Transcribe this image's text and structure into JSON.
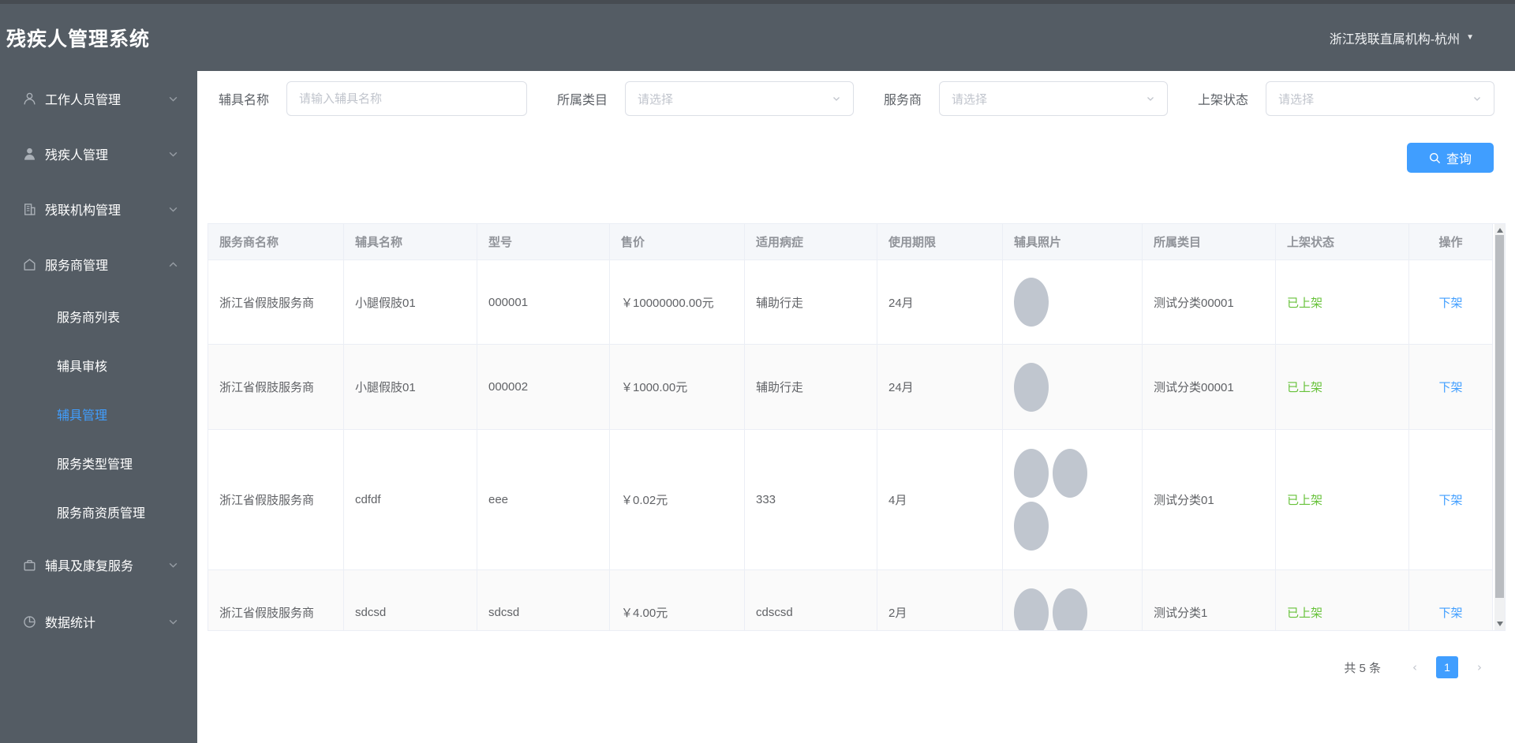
{
  "header": {
    "title": "残疾人管理系统",
    "org": "浙江残联直属机构-杭州"
  },
  "sidebar": {
    "items": [
      {
        "label": "工作人员管理",
        "icon": "user-outline-icon"
      },
      {
        "label": "残疾人管理",
        "icon": "user-solid-icon"
      },
      {
        "label": "残联机构管理",
        "icon": "building-icon"
      },
      {
        "label": "服务商管理",
        "icon": "home-icon",
        "children": [
          "服务商列表",
          "辅具审核",
          "辅具管理",
          "服务类型管理",
          "服务商资质管理"
        ],
        "active_child": "辅具管理"
      },
      {
        "label": "辅具及康复服务",
        "icon": "briefcase-icon"
      },
      {
        "label": "数据统计",
        "icon": "pie-chart-icon"
      }
    ]
  },
  "filters": {
    "name_label": "辅具名称",
    "name_placeholder": "请输入辅具名称",
    "category_label": "所属类目",
    "category_placeholder": "请选择",
    "provider_label": "服务商",
    "provider_placeholder": "请选择",
    "status_label": "上架状态",
    "status_placeholder": "请选择",
    "search_button": "查询"
  },
  "table": {
    "columns": [
      "服务商名称",
      "辅具名称",
      "型号",
      "售价",
      "适用病症",
      "使用期限",
      "辅具照片",
      "所属类目",
      "上架状态",
      "操作"
    ],
    "rows": [
      {
        "provider": "浙江省假肢服务商",
        "name": "小腿假肢01",
        "model": "000001",
        "price": "￥10000000.00元",
        "disease": "辅助行走",
        "period": "24月",
        "photos": 1,
        "category": "测试分类00001",
        "status": "已上架",
        "action": "下架"
      },
      {
        "provider": "浙江省假肢服务商",
        "name": "小腿假肢01",
        "model": "000002",
        "price": "￥1000.00元",
        "disease": "辅助行走",
        "period": "24月",
        "photos": 1,
        "category": "测试分类00001",
        "status": "已上架",
        "action": "下架"
      },
      {
        "provider": "浙江省假肢服务商",
        "name": "cdfdf",
        "model": "eee",
        "price": "￥0.02元",
        "disease": "333",
        "period": "4月",
        "photos": 3,
        "category": "测试分类01",
        "status": "已上架",
        "action": "下架"
      },
      {
        "provider": "浙江省假肢服务商",
        "name": "sdcsd",
        "model": "sdcsd",
        "price": "￥4.00元",
        "disease": "cdscsd",
        "period": "2月",
        "photos": 2,
        "category": "测试分类1",
        "status": "已上架",
        "action": "下架"
      }
    ]
  },
  "pagination": {
    "total": "共 5 条",
    "prev": "‹",
    "next": "›",
    "page": "1"
  },
  "colors": {
    "accent": "#409eff",
    "success": "#67c23a",
    "sidebar_bg": "#545c64",
    "photo_gray": "#c0c6cf"
  }
}
